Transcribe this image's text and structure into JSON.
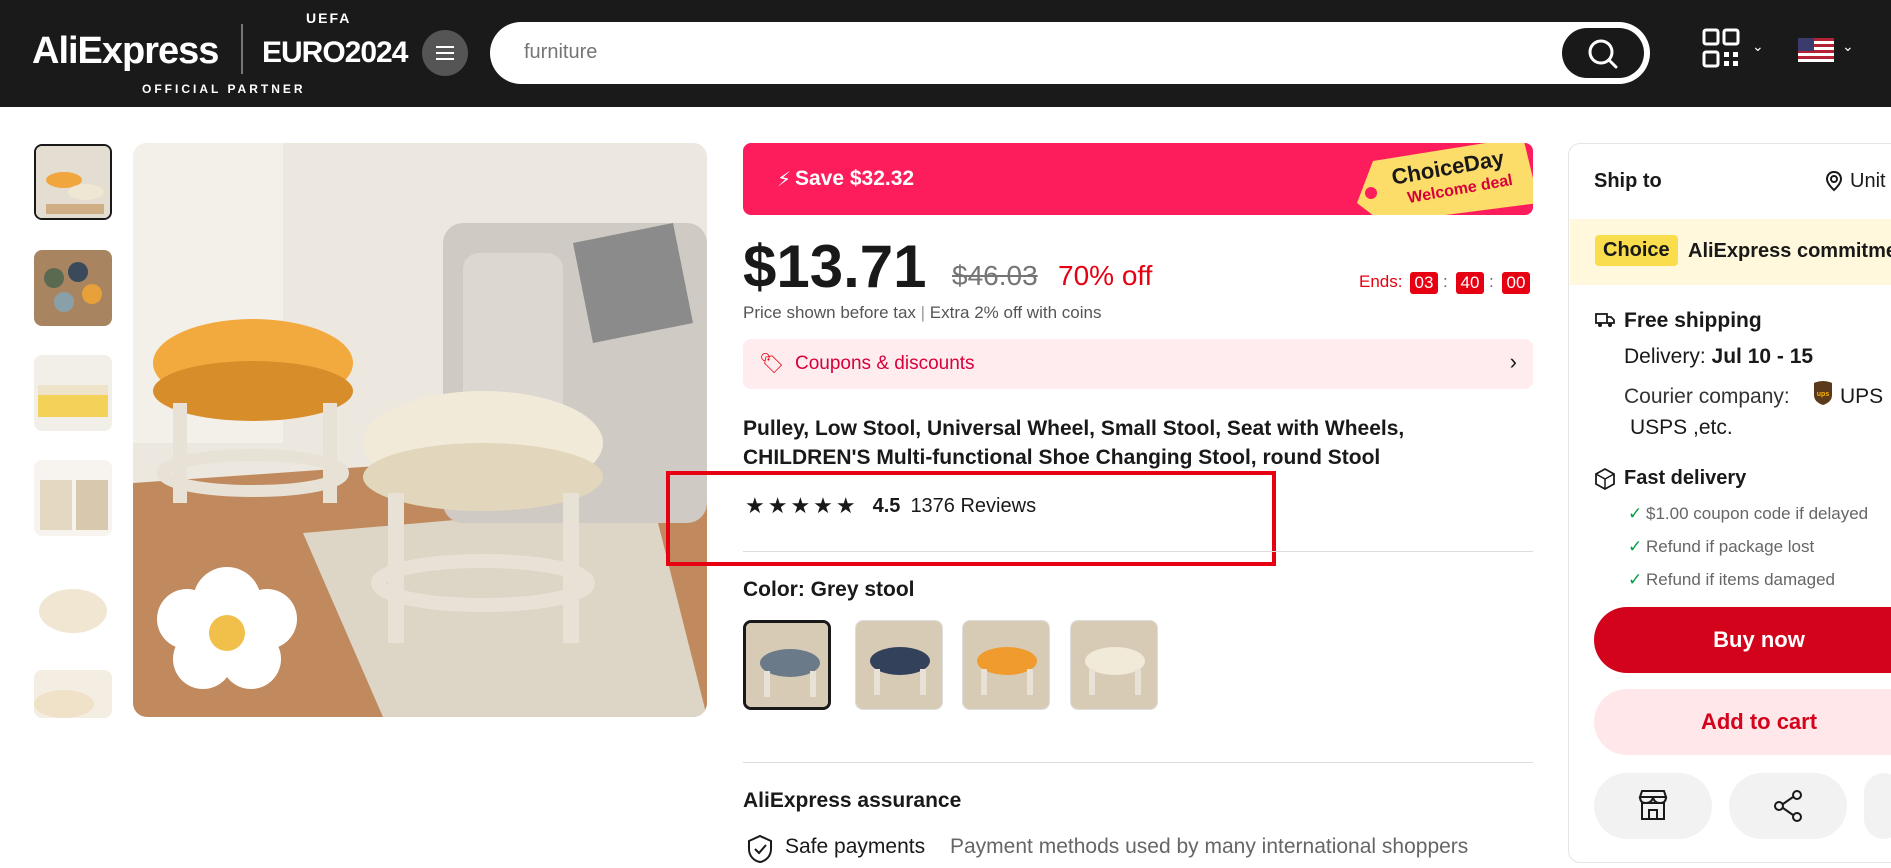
{
  "header": {
    "logo": "AliExpress",
    "euro": "EURO2024",
    "uefa": "UEFA",
    "partner": "OFFICIAL PARTNER",
    "search_placeholder": "furniture"
  },
  "gallery": {
    "thumbnail_count": 6
  },
  "promo": {
    "save": "Save $32.32",
    "tag_line1": "ChoiceDay",
    "tag_line2": "Welcome deal"
  },
  "pricing": {
    "price": "$13.71",
    "original": "$46.03",
    "discount": "70% off",
    "ends_label": "Ends:",
    "countdown": [
      "03",
      "40",
      "00"
    ],
    "tax_note": "Price shown before tax",
    "coins_note": "Extra 2% off with coins"
  },
  "coupons": {
    "label": "Coupons & discounts"
  },
  "product": {
    "title": "Pulley, Low Stool, Universal Wheel, Small Stool, Seat with Wheels, CHILDREN'S Multi-functional Shoe Changing Stool, round Stool",
    "rating": "4.5",
    "rating_value": 4.5,
    "reviews": "1376 Reviews",
    "color_label": "Color: Grey stool"
  },
  "assurance": {
    "title": "AliExpress assurance",
    "safe": "Safe payments",
    "safe_desc": "Payment methods used by many international shoppers"
  },
  "right_panel": {
    "ship_to": "Ship to",
    "ship_to_value": "Unit",
    "choice_badge": "Choice",
    "commitment": "AliExpress commitme",
    "free_shipping": "Free shipping",
    "delivery_label": "Delivery:",
    "delivery_dates": "Jul 10 - 15",
    "courier_label": "Courier company:",
    "courier_ups": "UPS",
    "courier_more": "USPS ,etc.",
    "fast_delivery": "Fast delivery",
    "benefits": [
      "$1.00 coupon code if delayed",
      "Refund if package lost",
      "Refund if items damaged"
    ],
    "buy_now": "Buy now",
    "add_to_cart": "Add to cart"
  },
  "colors": {
    "brand_red": "#fd1d5c",
    "button_red": "#d3031c",
    "price_red": "#e60012",
    "check_green": "#00a046"
  }
}
